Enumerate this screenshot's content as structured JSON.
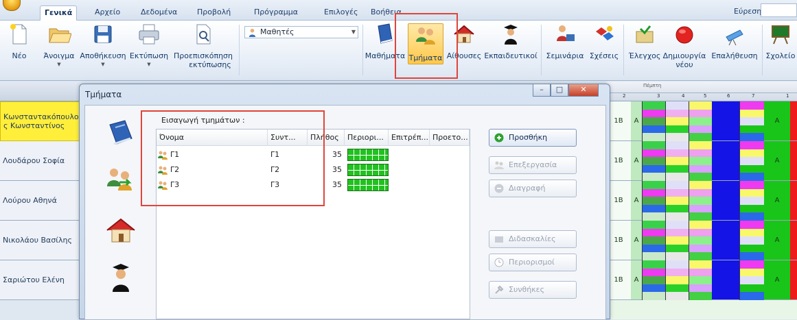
{
  "ribbon_tabs": [
    "Γενικά",
    "Αρχείο",
    "Δεδομένα",
    "Προβολή",
    "Πρόγραμμα",
    "Επιλογές",
    "Βοήθεια"
  ],
  "search": {
    "label": "Εύρεση:",
    "value": ""
  },
  "ribbon": {
    "new": "Νέο",
    "open": "Άνοιγμα",
    "save": "Αποθήκευση",
    "print": "Εκτύπωση",
    "preview_line1": "Προεπισκόπηση",
    "preview_line2": "εκτύπωσης",
    "students_combo": "Μαθητές",
    "courses": "Μαθήματα",
    "classes": "Τμήματα",
    "rooms": "Αίθουσες",
    "teachers": "Εκπαιδευτικοί",
    "seminars": "Σεμινάρια",
    "relations": "Σχέσεις",
    "check": "Έλεγχος",
    "create_line1": "Δημιουργία",
    "create_line2": "νέου",
    "verify": "Επαλήθευση",
    "school": "Σχολείο"
  },
  "grid": {
    "header_title": "Πέμπτη",
    "header_nums": [
      "2",
      "3",
      "4",
      "5",
      "6",
      "7",
      "1"
    ],
    "teachers": [
      "Κωνσταντακόπουλο ς Κωνσταντίνος",
      "Λουδάρου Σοφία",
      "Λούρου Αθηνά",
      "Νικολάου Βασίλης",
      "Σαριώτου Ελένη"
    ],
    "cell_letter": "Α",
    "cell_code": "1Β"
  },
  "dialog": {
    "title": "Τμήματα",
    "section_label": "Εισαγωγή τμημάτων :",
    "columns": [
      "Όνομα",
      "Συντ...",
      "Πλήθος",
      "Περιορι...",
      "Επιτρέπ...",
      "Προετο..."
    ],
    "rows": [
      {
        "name": "Γ1",
        "short": "Γ1",
        "count": "35"
      },
      {
        "name": "Γ2",
        "short": "Γ2",
        "count": "35"
      },
      {
        "name": "Γ3",
        "short": "Γ3",
        "count": "35"
      }
    ],
    "buttons": {
      "add": "Προσθήκη",
      "edit": "Επεξεργασία",
      "delete": "Διαγραφή",
      "lessons": "Διδασκαλίες",
      "constraints": "Περιορισμοί",
      "conditions": "Συνθήκες"
    }
  },
  "colors": {
    "highlight": "#e0443a",
    "selected_row": "#ffef3a",
    "bar_green": "#21c11f"
  }
}
